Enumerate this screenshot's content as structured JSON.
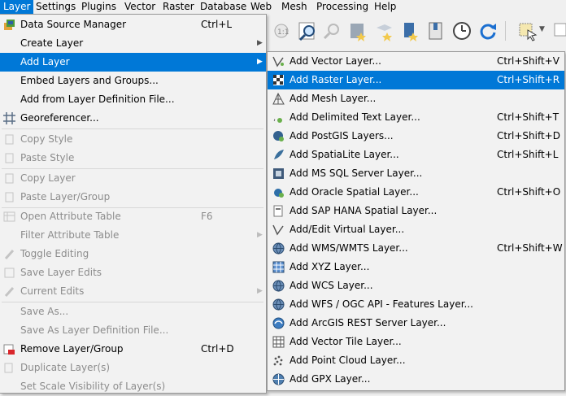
{
  "menubar": {
    "items": [
      "Layer",
      "Settings",
      "Plugins",
      "Vector",
      "Raster",
      "Database",
      "Web",
      "Mesh",
      "Processing",
      "Help"
    ]
  },
  "layer_menu": {
    "items": [
      {
        "label": "Data Source Manager",
        "shortcut": "Ctrl+L"
      },
      {
        "label": "Create Layer"
      },
      {
        "label": "Add Layer"
      },
      {
        "label": "Embed Layers and Groups..."
      },
      {
        "label": "Add from Layer Definition File..."
      },
      {
        "label": "Georeferencer..."
      },
      {
        "label": "Copy Style"
      },
      {
        "label": "Paste Style"
      },
      {
        "label": "Copy Layer"
      },
      {
        "label": "Paste Layer/Group"
      },
      {
        "label": "Open Attribute Table",
        "shortcut": "F6"
      },
      {
        "label": "Filter Attribute Table"
      },
      {
        "label": "Toggle Editing"
      },
      {
        "label": "Save Layer Edits"
      },
      {
        "label": "Current Edits"
      },
      {
        "label": "Save As..."
      },
      {
        "label": "Save As Layer Definition File..."
      },
      {
        "label": "Remove Layer/Group",
        "shortcut": "Ctrl+D"
      },
      {
        "label": "Duplicate Layer(s)"
      },
      {
        "label": "Set Scale Visibility of Layer(s)"
      }
    ]
  },
  "add_layer_menu": {
    "items": [
      {
        "label": "Add Vector Layer...",
        "shortcut": "Ctrl+Shift+V"
      },
      {
        "label": "Add Raster Layer...",
        "shortcut": "Ctrl+Shift+R"
      },
      {
        "label": "Add Mesh Layer..."
      },
      {
        "label": "Add Delimited Text Layer...",
        "shortcut": "Ctrl+Shift+T"
      },
      {
        "label": "Add PostGIS Layers...",
        "shortcut": "Ctrl+Shift+D"
      },
      {
        "label": "Add SpatiaLite Layer...",
        "shortcut": "Ctrl+Shift+L"
      },
      {
        "label": "Add MS SQL Server Layer..."
      },
      {
        "label": "Add Oracle Spatial Layer...",
        "shortcut": "Ctrl+Shift+O"
      },
      {
        "label": "Add SAP HANA Spatial Layer..."
      },
      {
        "label": "Add/Edit Virtual Layer..."
      },
      {
        "label": "Add WMS/WMTS Layer...",
        "shortcut": "Ctrl+Shift+W"
      },
      {
        "label": "Add XYZ Layer..."
      },
      {
        "label": "Add WCS Layer..."
      },
      {
        "label": "Add WFS / OGC API - Features Layer..."
      },
      {
        "label": "Add ArcGIS REST Server Layer..."
      },
      {
        "label": "Add Vector Tile Layer..."
      },
      {
        "label": "Add Point Cloud Layer..."
      },
      {
        "label": "Add GPX Layer..."
      }
    ]
  },
  "colors": {
    "highlight": "#0078d7",
    "disabled_text": "#8c8c8c",
    "menu_bg": "#f2f2f2"
  }
}
